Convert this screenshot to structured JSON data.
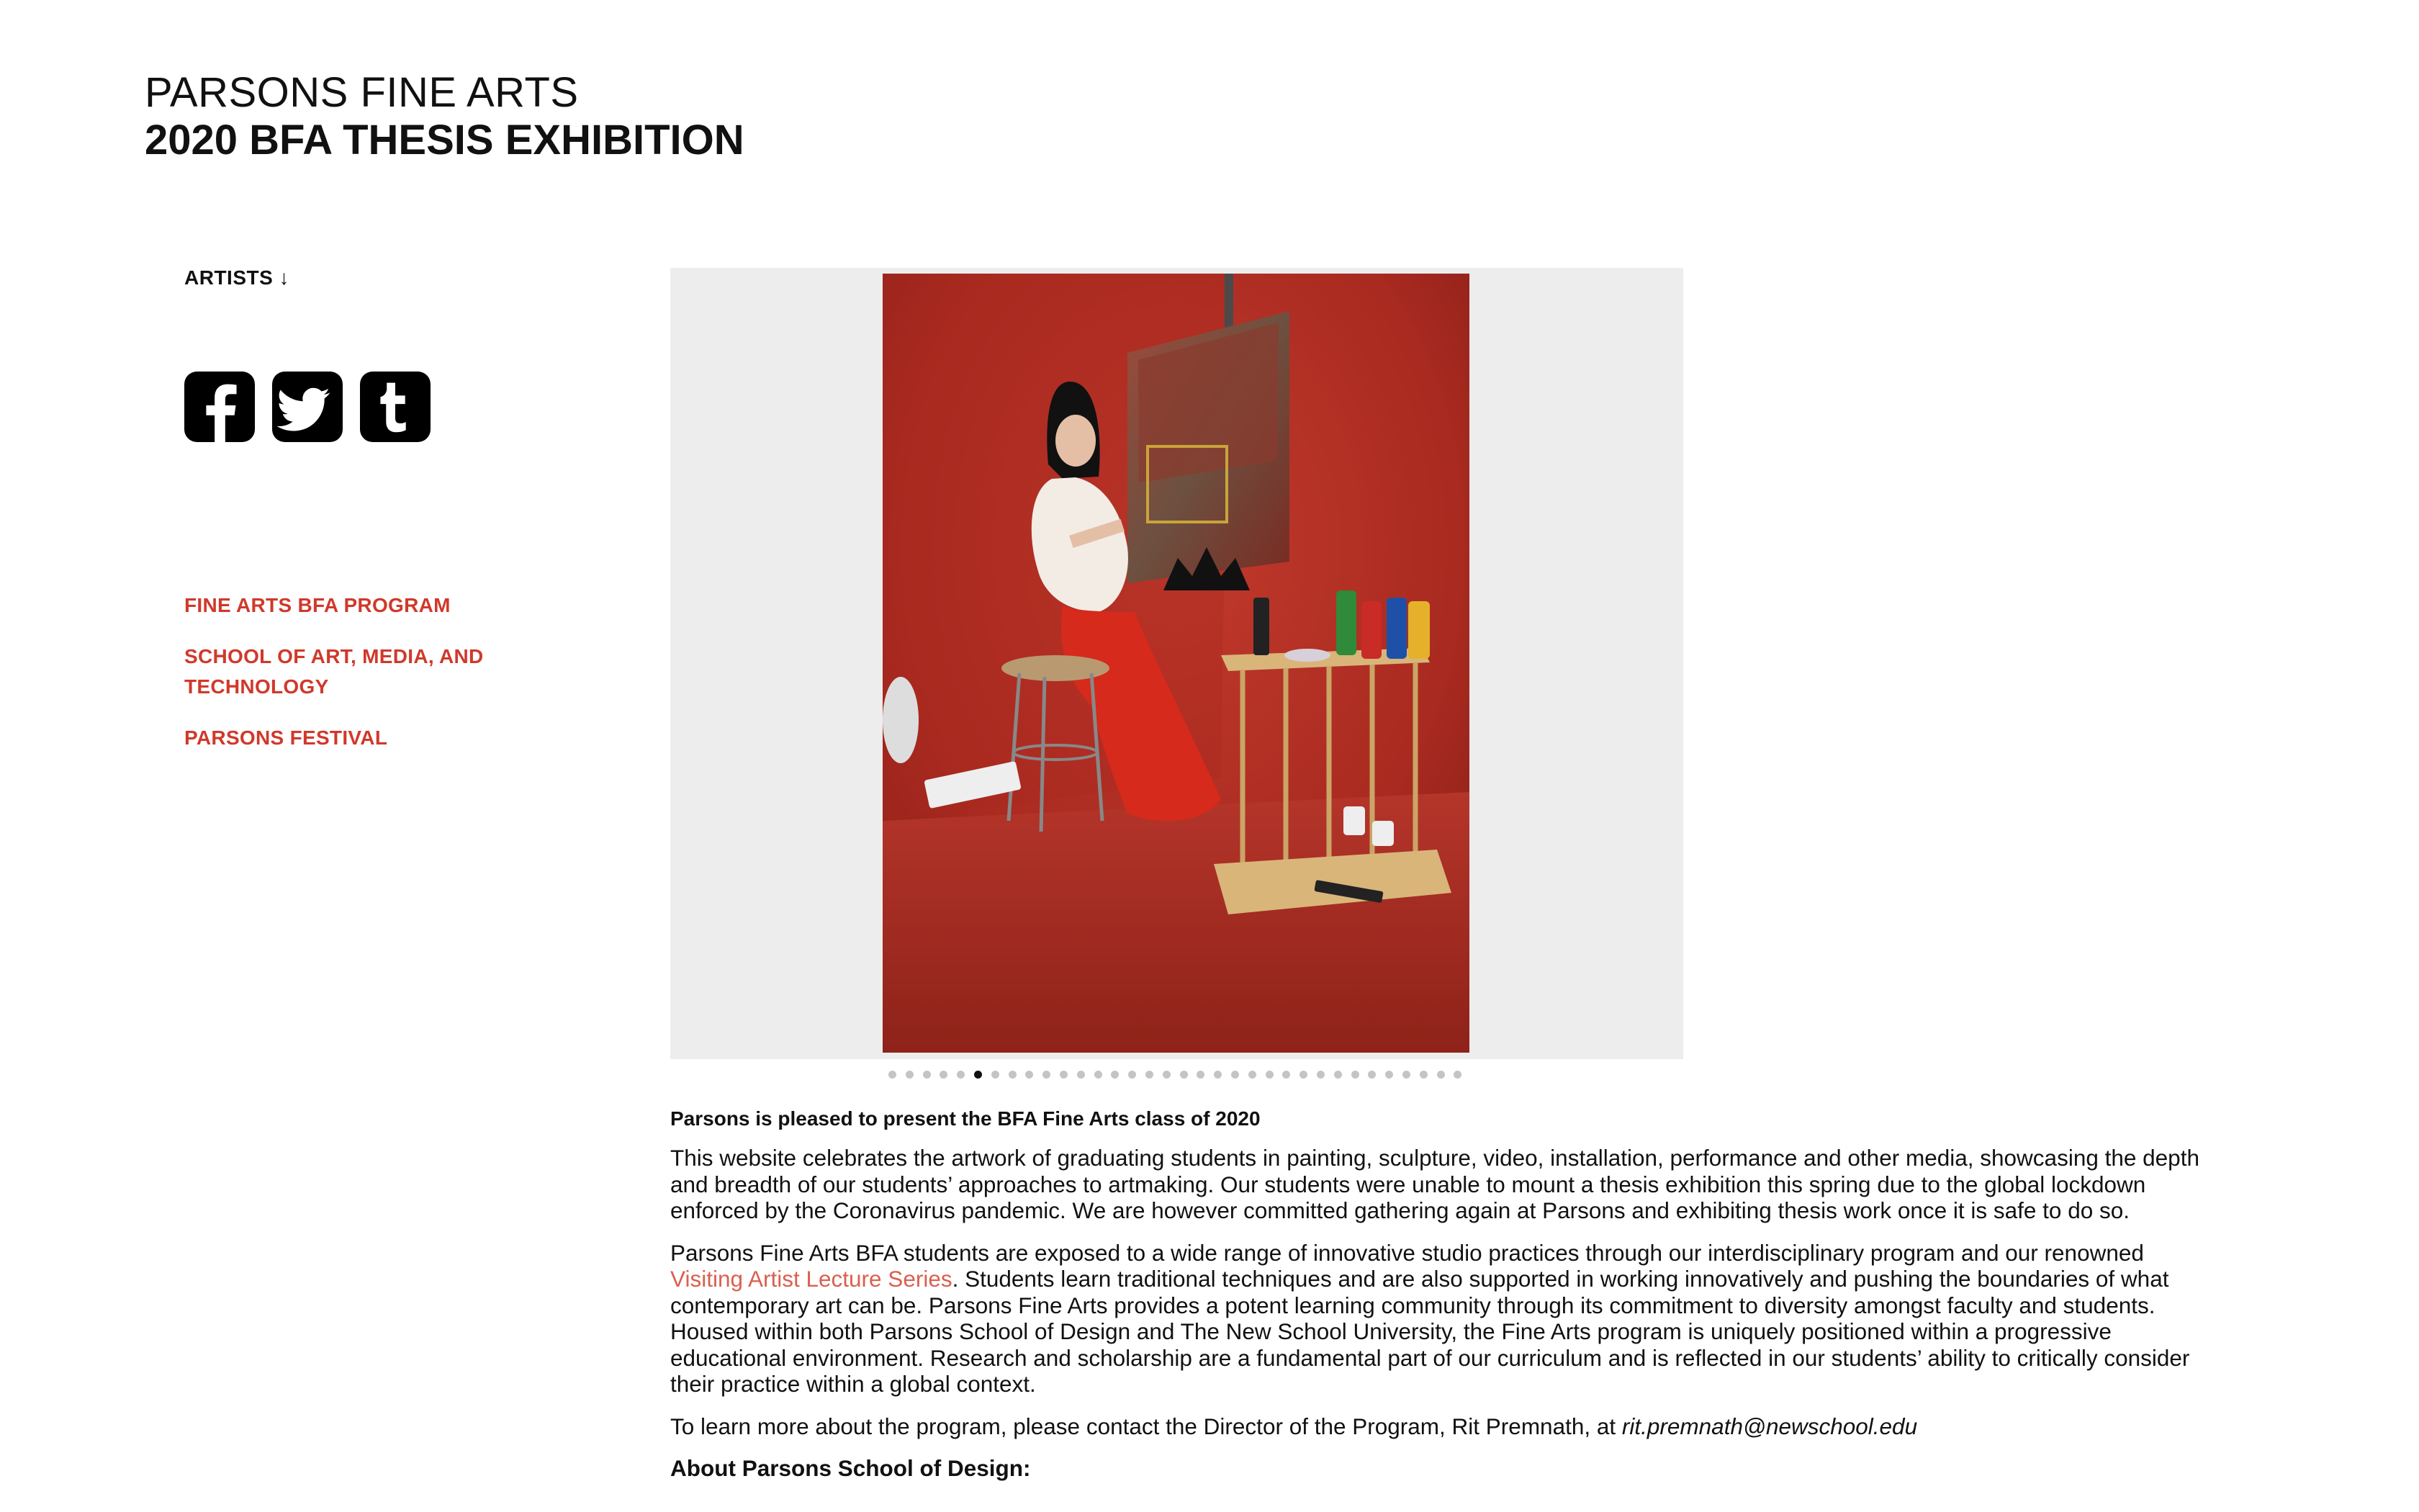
{
  "header": {
    "title_line1": "PARSONS FINE ARTS",
    "title_line2": "2020 BFA THESIS EXHIBITION"
  },
  "sidebar": {
    "artists_label": "ARTISTS ↓",
    "social": [
      {
        "name": "facebook-icon"
      },
      {
        "name": "twitter-icon"
      },
      {
        "name": "tumblr-icon"
      }
    ],
    "links": [
      {
        "label": "FINE ARTS BFA PROGRAM"
      },
      {
        "label": "SCHOOL OF ART, MEDIA, AND TECHNOLOGY"
      },
      {
        "label": "PARSONS FESTIVAL"
      }
    ]
  },
  "slideshow": {
    "image_alt": "Artist in red painted studio sitting at easel with paints",
    "dot_count": 34,
    "active_index": 5
  },
  "content": {
    "lead": "Parsons is pleased to present the BFA Fine Arts class of 2020",
    "para1": "This website celebrates the artwork of graduating students in painting, sculpture, video, installation, performance and other media, showcasing the depth and breadth of our students’ approaches to artmaking. Our students were unable to mount a thesis exhibition this spring due to the global lockdown enforced by the Coronavirus pandemic. We are however committed gathering again at Parsons and exhibiting thesis work once it is safe to do so.",
    "para2_before": "Parsons Fine Arts BFA students are exposed to a wide range of innovative studio practices through our interdisciplinary program and our renowned ",
    "para2_link": "Visiting Artist Lecture Series",
    "para2_after": ". Students learn traditional techniques and are also supported in working innovatively and pushing the boundaries of what contemporary art can be. Parsons Fine Arts provides a potent learning community through its commitment to diversity amongst faculty and students. Housed within both Parsons School of Design and The New School University, the Fine Arts program is uniquely positioned within a progressive educational environment. Research and scholarship are a fundamental part of our curriculum and is reflected in our students’ ability to critically consider their practice within a global context.",
    "para3_text": "To learn more about the program, please contact the Director of the Program, Rit Premnath, at ",
    "para3_email": "rit.premnath@newschool.edu",
    "about_heading": "About Parsons School of Design:"
  },
  "colors": {
    "link_red": "#d0392b",
    "inline_link": "#d9604f",
    "slide_bg": "#ededed"
  }
}
